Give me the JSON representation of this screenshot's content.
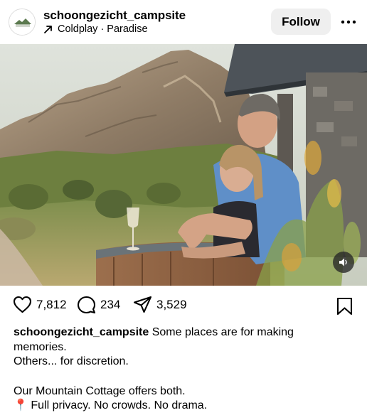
{
  "post": {
    "username": "schoongezicht_campsite",
    "music": {
      "icon": "trending-arrow-icon",
      "text": "Coldplay · Paradise"
    },
    "follow_label": "Follow",
    "more_icon": "more-horizontal-icon"
  },
  "media": {
    "type": "video",
    "description_icon": "sound-icon"
  },
  "actions": {
    "likes": "7,812",
    "comments": "234",
    "shares": "3,529"
  },
  "caption": {
    "username": "schoongezicht_campsite",
    "first_line_rest": "Some places are for making",
    "line2": "memories.",
    "line3": "Others... for discretion.",
    "line4": "Our Mountain Cottage offers both.",
    "pin_icon": "📍",
    "line5": "Full privacy. No crowds. No drama."
  },
  "colors": {
    "follow_bg": "#efefef",
    "text": "#000000"
  }
}
